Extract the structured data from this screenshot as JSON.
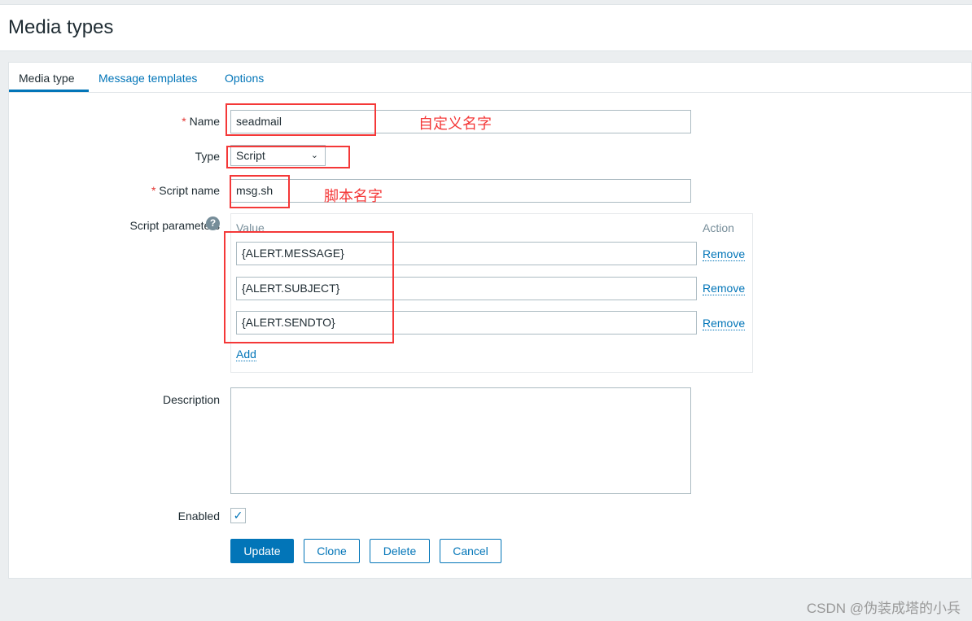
{
  "page": {
    "title": "Media types"
  },
  "tabs": [
    {
      "label": "Media type"
    },
    {
      "label": "Message templates"
    },
    {
      "label": "Options"
    }
  ],
  "form": {
    "name_label": "Name",
    "name_value": "seadmail",
    "type_label": "Type",
    "type_value": "Script",
    "script_name_label": "Script name",
    "script_name_value": "msg.sh",
    "params_label": "Script parameters",
    "params_header_value": "Value",
    "params_header_action": "Action",
    "params": [
      {
        "value": "{ALERT.MESSAGE}",
        "remove": "Remove"
      },
      {
        "value": "{ALERT.SUBJECT}",
        "remove": "Remove"
      },
      {
        "value": "{ALERT.SENDTO}",
        "remove": "Remove"
      }
    ],
    "add_label": "Add",
    "description_label": "Description",
    "description_value": "",
    "enabled_label": "Enabled",
    "enabled": true,
    "required_mark": "*"
  },
  "buttons": {
    "update": "Update",
    "clone": "Clone",
    "delete": "Delete",
    "cancel": "Cancel"
  },
  "annotations": {
    "name_note": "自定义名字",
    "script_note": "脚本名字"
  },
  "watermark": "CSDN @伪装成塔的小兵",
  "colors": {
    "accent": "#0275b8",
    "annotation": "#f43838"
  }
}
